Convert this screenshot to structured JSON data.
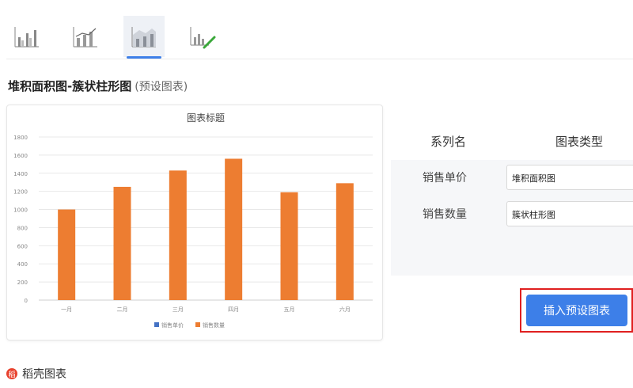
{
  "toolbar": {
    "chart_types": [
      {
        "name": "grouped-bar-icon"
      },
      {
        "name": "bar-line-icon"
      },
      {
        "name": "stacked-area-bar-icon",
        "active": true
      },
      {
        "name": "custom-chart-icon"
      }
    ]
  },
  "section": {
    "title": "堆积面积图-簇状柱形图",
    "subtitle": "(预设图表)"
  },
  "chart_data": {
    "type": "bar",
    "title": "图表标题",
    "categories": [
      "一月",
      "二月",
      "三月",
      "四月",
      "五月",
      "六月"
    ],
    "series": [
      {
        "name": "销售单价",
        "values": [
          0,
          0,
          0,
          0,
          0,
          0
        ],
        "color": "#4472c4"
      },
      {
        "name": "销售数量",
        "values": [
          1000,
          1250,
          1430,
          1560,
          1190,
          1290
        ],
        "color": "#ed7d31"
      }
    ],
    "ylim": [
      0,
      1800
    ],
    "yticks": [
      0,
      200,
      400,
      600,
      800,
      1000,
      1200,
      1400,
      1600,
      1800
    ],
    "grid": true,
    "legend": "bottom"
  },
  "series_panel": {
    "header_name": "系列名",
    "header_type": "图表类型",
    "rows": [
      {
        "name": "销售单价",
        "type": "堆积面积图"
      },
      {
        "name": "销售数量",
        "type": "簇状柱形图"
      }
    ]
  },
  "insert_button": "插入预设图表",
  "brand": {
    "logo": "稻",
    "text": "稻壳图表"
  }
}
